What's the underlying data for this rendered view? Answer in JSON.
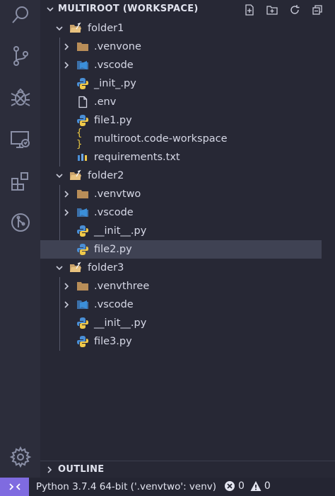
{
  "workspace": {
    "title": "MULTIROOT (WORKSPACE)",
    "actions": [
      "new-file",
      "new-folder",
      "refresh",
      "collapse-all"
    ]
  },
  "tree": {
    "folder1": {
      "label": "folder1",
      "items": [
        {
          "label": ".venvone",
          "type": "folder"
        },
        {
          "label": ".vscode",
          "type": "vscode-folder"
        },
        {
          "label": "_init_.py",
          "type": "python"
        },
        {
          "label": ".env",
          "type": "file"
        },
        {
          "label": "file1.py",
          "type": "python"
        },
        {
          "label": "multiroot.code-workspace",
          "type": "json"
        },
        {
          "label": "requirements.txt",
          "type": "requirements"
        }
      ]
    },
    "folder2": {
      "label": "folder2",
      "items": [
        {
          "label": ".venvtwo",
          "type": "folder"
        },
        {
          "label": ".vscode",
          "type": "vscode-folder"
        },
        {
          "label": "__init__.py",
          "type": "python"
        },
        {
          "label": "file2.py",
          "type": "python",
          "selected": true
        }
      ]
    },
    "folder3": {
      "label": "folder3",
      "items": [
        {
          "label": ".venvthree",
          "type": "folder"
        },
        {
          "label": ".vscode",
          "type": "vscode-folder"
        },
        {
          "label": "__init__.py",
          "type": "python"
        },
        {
          "label": "file3.py",
          "type": "python"
        }
      ]
    }
  },
  "outline": {
    "title": "OUTLINE"
  },
  "statusbar": {
    "python": "Python 3.7.4 64-bit ('.venvtwo': venv)",
    "errors": "0",
    "warnings": "0"
  },
  "colors": {
    "accent": "#7f6be0",
    "selection": "#3f4253",
    "folder": "#c9a26b",
    "python_blue": "#4a8fd6",
    "python_yellow": "#f0c94a",
    "vscode": "#3b8fd9",
    "json": "#e5c442"
  }
}
